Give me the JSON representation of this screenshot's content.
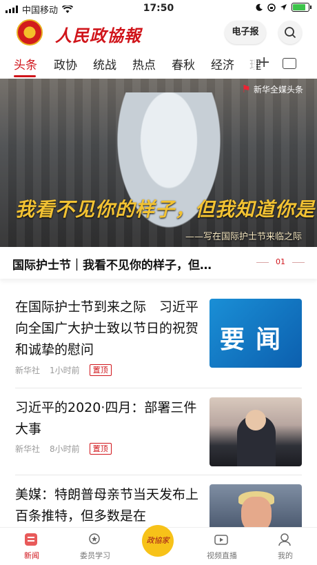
{
  "status_bar": {
    "carrier": "中国移动",
    "time": "17:50"
  },
  "header": {
    "brand": "人民政協報",
    "epaper_label": "电子报"
  },
  "tabs": [
    {
      "label": "头条"
    },
    {
      "label": "政协"
    },
    {
      "label": "统战"
    },
    {
      "label": "热点"
    },
    {
      "label": "春秋"
    },
    {
      "label": "经济"
    },
    {
      "label": "理"
    }
  ],
  "banner": {
    "source_tag": "新华全媒头条",
    "caption": "我看不见你的样子，但我知道你是谁",
    "subcaption": "——写在国际护士节来临之际"
  },
  "headline": {
    "text": "国际护士节｜我看不见你的样子，但…",
    "page_indicator": "01"
  },
  "news": [
    {
      "title": "在国际护士节到来之际　习近平向全国广大护士致以节日的祝贺和诚挚的慰问",
      "source": "新华社",
      "time": "1小时前",
      "pin": "置顶",
      "thumb_text": "要闻"
    },
    {
      "title": "习近平的2020·四月：部署三件大事",
      "source": "新华社",
      "time": "8小时前",
      "pin": "置顶"
    },
    {
      "title": "美媒：特朗普母亲节当天发布上百条推特，但多数是在"
    }
  ],
  "tabbar": [
    {
      "label": "新闻",
      "icon": "news-icon"
    },
    {
      "label": "委员学习",
      "icon": "medal-icon"
    },
    {
      "label": "政協家",
      "icon": "center-logo-icon"
    },
    {
      "label": "视频直播",
      "icon": "video-icon"
    },
    {
      "label": "我的",
      "icon": "profile-icon"
    }
  ],
  "colors": {
    "accent": "#d0141a",
    "caption_gold": "#f2c233",
    "center_button": "#f7c219"
  }
}
